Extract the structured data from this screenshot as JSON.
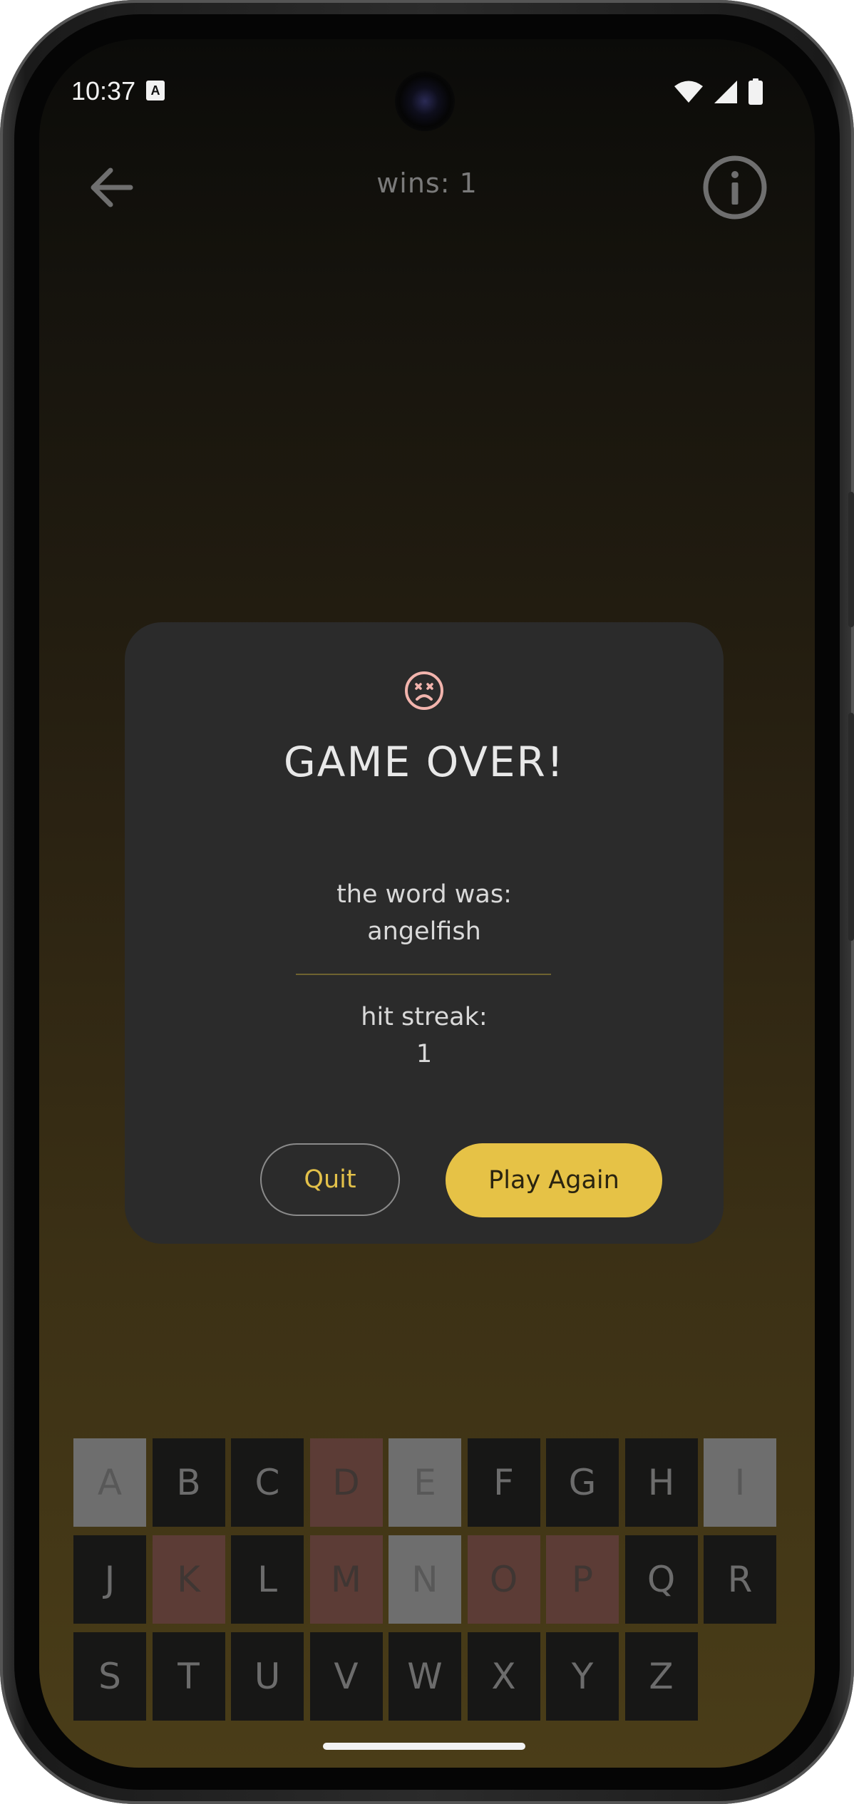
{
  "status_bar": {
    "time": "10:37",
    "notification_icon_label": "A"
  },
  "top_bar": {
    "title": "wins: 1",
    "back_icon": "arrow-left-icon",
    "info_icon": "info-icon"
  },
  "dialog": {
    "icon": "sad-face-icon",
    "icon_color": "#f2b4ad",
    "title": "GAME OVER!",
    "word_label": "the word was:",
    "word_value": "angelfish",
    "streak_label": "hit streak:",
    "streak_value": "1",
    "quit_label": "Quit",
    "play_again_label": "Play Again",
    "accent_color": "#e6c246"
  },
  "keyboard": {
    "rows": [
      [
        {
          "letter": "A",
          "state": "absent"
        },
        {
          "letter": "B",
          "state": "unused"
        },
        {
          "letter": "C",
          "state": "unused"
        },
        {
          "letter": "D",
          "state": "wrong"
        },
        {
          "letter": "E",
          "state": "absent"
        },
        {
          "letter": "F",
          "state": "unused"
        },
        {
          "letter": "G",
          "state": "unused"
        },
        {
          "letter": "H",
          "state": "unused"
        },
        {
          "letter": "I",
          "state": "absent"
        }
      ],
      [
        {
          "letter": "J",
          "state": "unused"
        },
        {
          "letter": "K",
          "state": "wrong"
        },
        {
          "letter": "L",
          "state": "unused"
        },
        {
          "letter": "M",
          "state": "wrong"
        },
        {
          "letter": "N",
          "state": "absent"
        },
        {
          "letter": "O",
          "state": "wrong"
        },
        {
          "letter": "P",
          "state": "wrong"
        },
        {
          "letter": "Q",
          "state": "unused"
        },
        {
          "letter": "R",
          "state": "unused"
        }
      ],
      [
        {
          "letter": "S",
          "state": "unused"
        },
        {
          "letter": "T",
          "state": "unused"
        },
        {
          "letter": "U",
          "state": "unused"
        },
        {
          "letter": "V",
          "state": "unused"
        },
        {
          "letter": "W",
          "state": "unused"
        },
        {
          "letter": "X",
          "state": "unused"
        },
        {
          "letter": "Y",
          "state": "unused"
        },
        {
          "letter": "Z",
          "state": "unused"
        }
      ]
    ]
  }
}
